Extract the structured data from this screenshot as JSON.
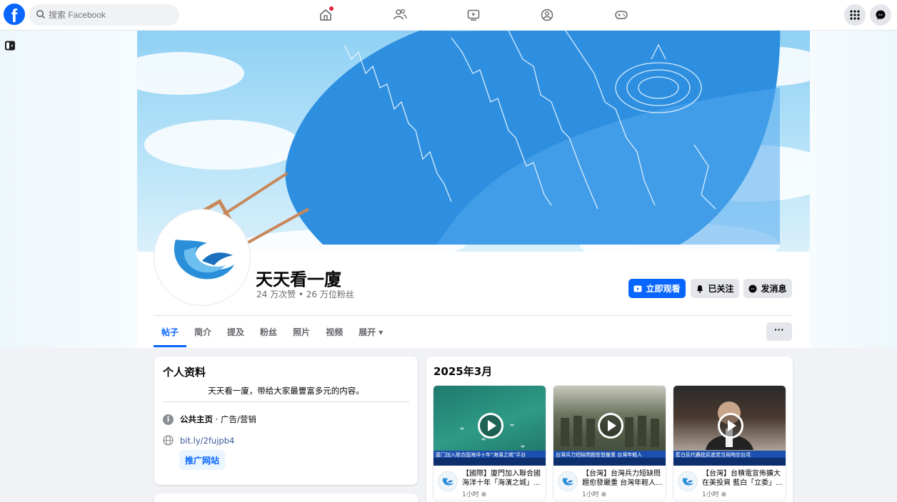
{
  "topbar": {
    "logo_letter": "f",
    "search_placeholder": "搜索 Facebook"
  },
  "page": {
    "name": "天天看一廈",
    "stats": "24 万次赞 • 26 万位粉丝",
    "buttons": {
      "watch": "立即观看",
      "following": "已关注",
      "message": "发消息"
    }
  },
  "tabs": [
    {
      "label": "帖子"
    },
    {
      "label": "简介"
    },
    {
      "label": "提及"
    },
    {
      "label": "粉丝"
    },
    {
      "label": "照片"
    },
    {
      "label": "视频"
    },
    {
      "label": "展开 ▾"
    }
  ],
  "more_label": "···",
  "intro": {
    "title": "个人资料",
    "bio": "天天看一廈，带给大家最豐富多元的内容。",
    "category_bold": "公共主页",
    "category_rest": " · 广告/营销",
    "link": "bit.ly/2fujpb4",
    "promo_button": "推广网站"
  },
  "videos": {
    "month": "2025年3月",
    "items": [
      {
        "caption": "廈门加入联合国海洋十年“海濱之城”平台",
        "title": "【國際】廈門加入聯合國海洋十年「海濱之城」...",
        "time": "1小时"
      },
      {
        "caption": "台灣兵力短缺問題愈發嚴重 台灣年輕人",
        "title": "【台灣】台灣兵力短缺問題愈發嚴重 台灣年輕人...",
        "time": "1小时"
      },
      {
        "caption": "藍白民代轟批民進党当局陶空台湾",
        "title": "【台灣】台積電宣佈擴大在美投資 藍白「立委」...",
        "time": "1小时"
      }
    ]
  },
  "colors": {
    "brand": "#0866ff",
    "background": "#f0f2f5"
  }
}
